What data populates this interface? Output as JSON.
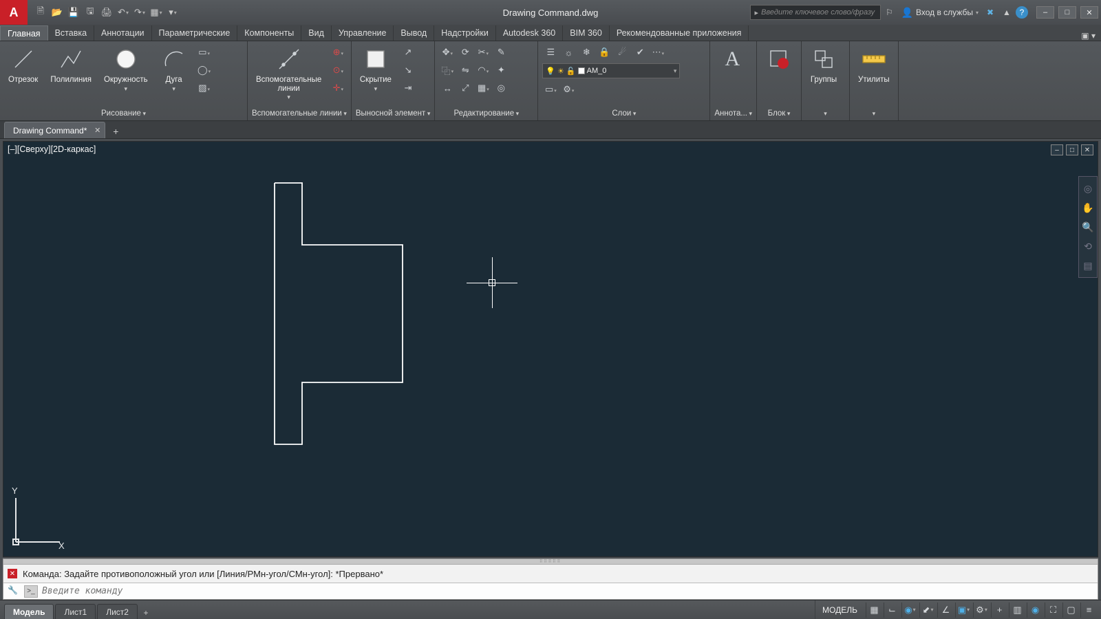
{
  "title": "Drawing Command.dwg",
  "qat": [
    "new",
    "open",
    "save",
    "saveas",
    "print",
    "undo",
    "redo",
    "workspace"
  ],
  "search_placeholder": "Введите ключевое слово/фразу",
  "signin": "Вход в службы",
  "wincontrols": [
    "–",
    "□",
    "✕"
  ],
  "tabs": [
    "Главная",
    "Вставка",
    "Аннотации",
    "Параметрические",
    "Компоненты",
    "Вид",
    "Управление",
    "Вывод",
    "Надстройки",
    "Autodesk 360",
    "BIM 360",
    "Рекомендованные приложения"
  ],
  "active_tab": 0,
  "ribbon": {
    "draw": {
      "label": "Рисование",
      "items": [
        "Отрезок",
        "Полилиния",
        "Окружность",
        "Дуга"
      ]
    },
    "construction": {
      "label": "Вспомогательные линии",
      "big": "Вспомогательные\nлинии"
    },
    "leader": {
      "label": "Выносной элемент",
      "big": "Скрытие"
    },
    "modify": {
      "label": "Редактирование"
    },
    "layer": {
      "label": "Слои",
      "current": "AM_0"
    },
    "annot": {
      "label": "Аннота..."
    },
    "block": {
      "label": "Блок"
    },
    "group": {
      "label": "Группы"
    },
    "util": {
      "label": "Утилиты"
    }
  },
  "filetab": "Drawing Command*",
  "viewport_label": "[–][Сверху][2D-каркас]",
  "ucs": {
    "x": "X",
    "y": "Y"
  },
  "cmd_history": "Команда: Задайте противоположный угол или [Линия/РМн-угол/СМн-угол]: *Прервано*",
  "cmd_placeholder": "Введите команду",
  "model_tabs": [
    "Модель",
    "Лист1",
    "Лист2"
  ],
  "model_active": 0,
  "status_label": "МОДЕЛЬ"
}
